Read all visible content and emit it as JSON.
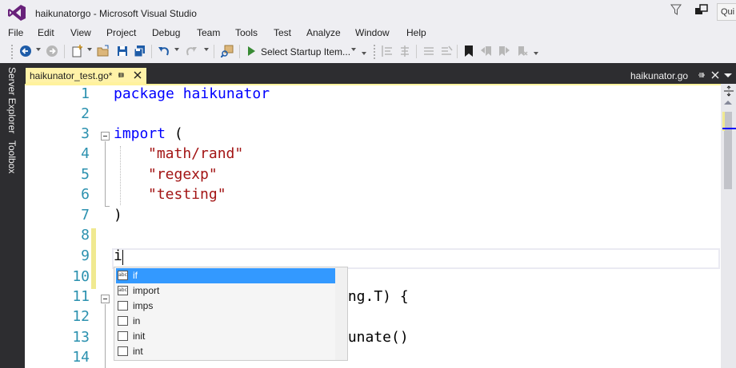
{
  "window": {
    "title": "haikunatorgo - Microsoft Visual Studio",
    "quick_launch": "Qui"
  },
  "menu": [
    "File",
    "Edit",
    "View",
    "Project",
    "Debug",
    "Team",
    "Tools",
    "Test",
    "Analyze",
    "Window",
    "Help"
  ],
  "toolbar": {
    "startup_label": "Select Startup Item..."
  },
  "rail": {
    "server_explorer": "Server Explorer",
    "toolbox": "Toolbox"
  },
  "tabs": {
    "active": "haikunator_test.go*",
    "preview": "haikunator.go"
  },
  "editor": {
    "line_numbers": [
      "1",
      "2",
      "3",
      "4",
      "5",
      "6",
      "7",
      "8",
      "9",
      "10",
      "11",
      "12",
      "13",
      "14"
    ],
    "lines": {
      "l1_kw": "package",
      "l1_rest": " haikunator",
      "l3_kw": "import",
      "l3_rest": " (",
      "l4": "\"math/rand\"",
      "l5": "\"regexp\"",
      "l6": "\"testing\"",
      "l7": ")",
      "l9": "i",
      "l11_tail": "ing.T) {",
      "l13_tail": "kunate()"
    }
  },
  "completion": {
    "items": [
      {
        "label": "if",
        "icon": "abc"
      },
      {
        "label": "import",
        "icon": "abc"
      },
      {
        "label": "imps",
        "icon": ""
      },
      {
        "label": "in",
        "icon": ""
      },
      {
        "label": "init",
        "icon": ""
      },
      {
        "label": "int",
        "icon": ""
      }
    ],
    "selected_index": 0
  },
  "colors": {
    "keyword": "#0000ff",
    "string": "#a31515",
    "line_number": "#2b91af",
    "selection": "#3399ff",
    "tab_active": "#fff2a8"
  }
}
